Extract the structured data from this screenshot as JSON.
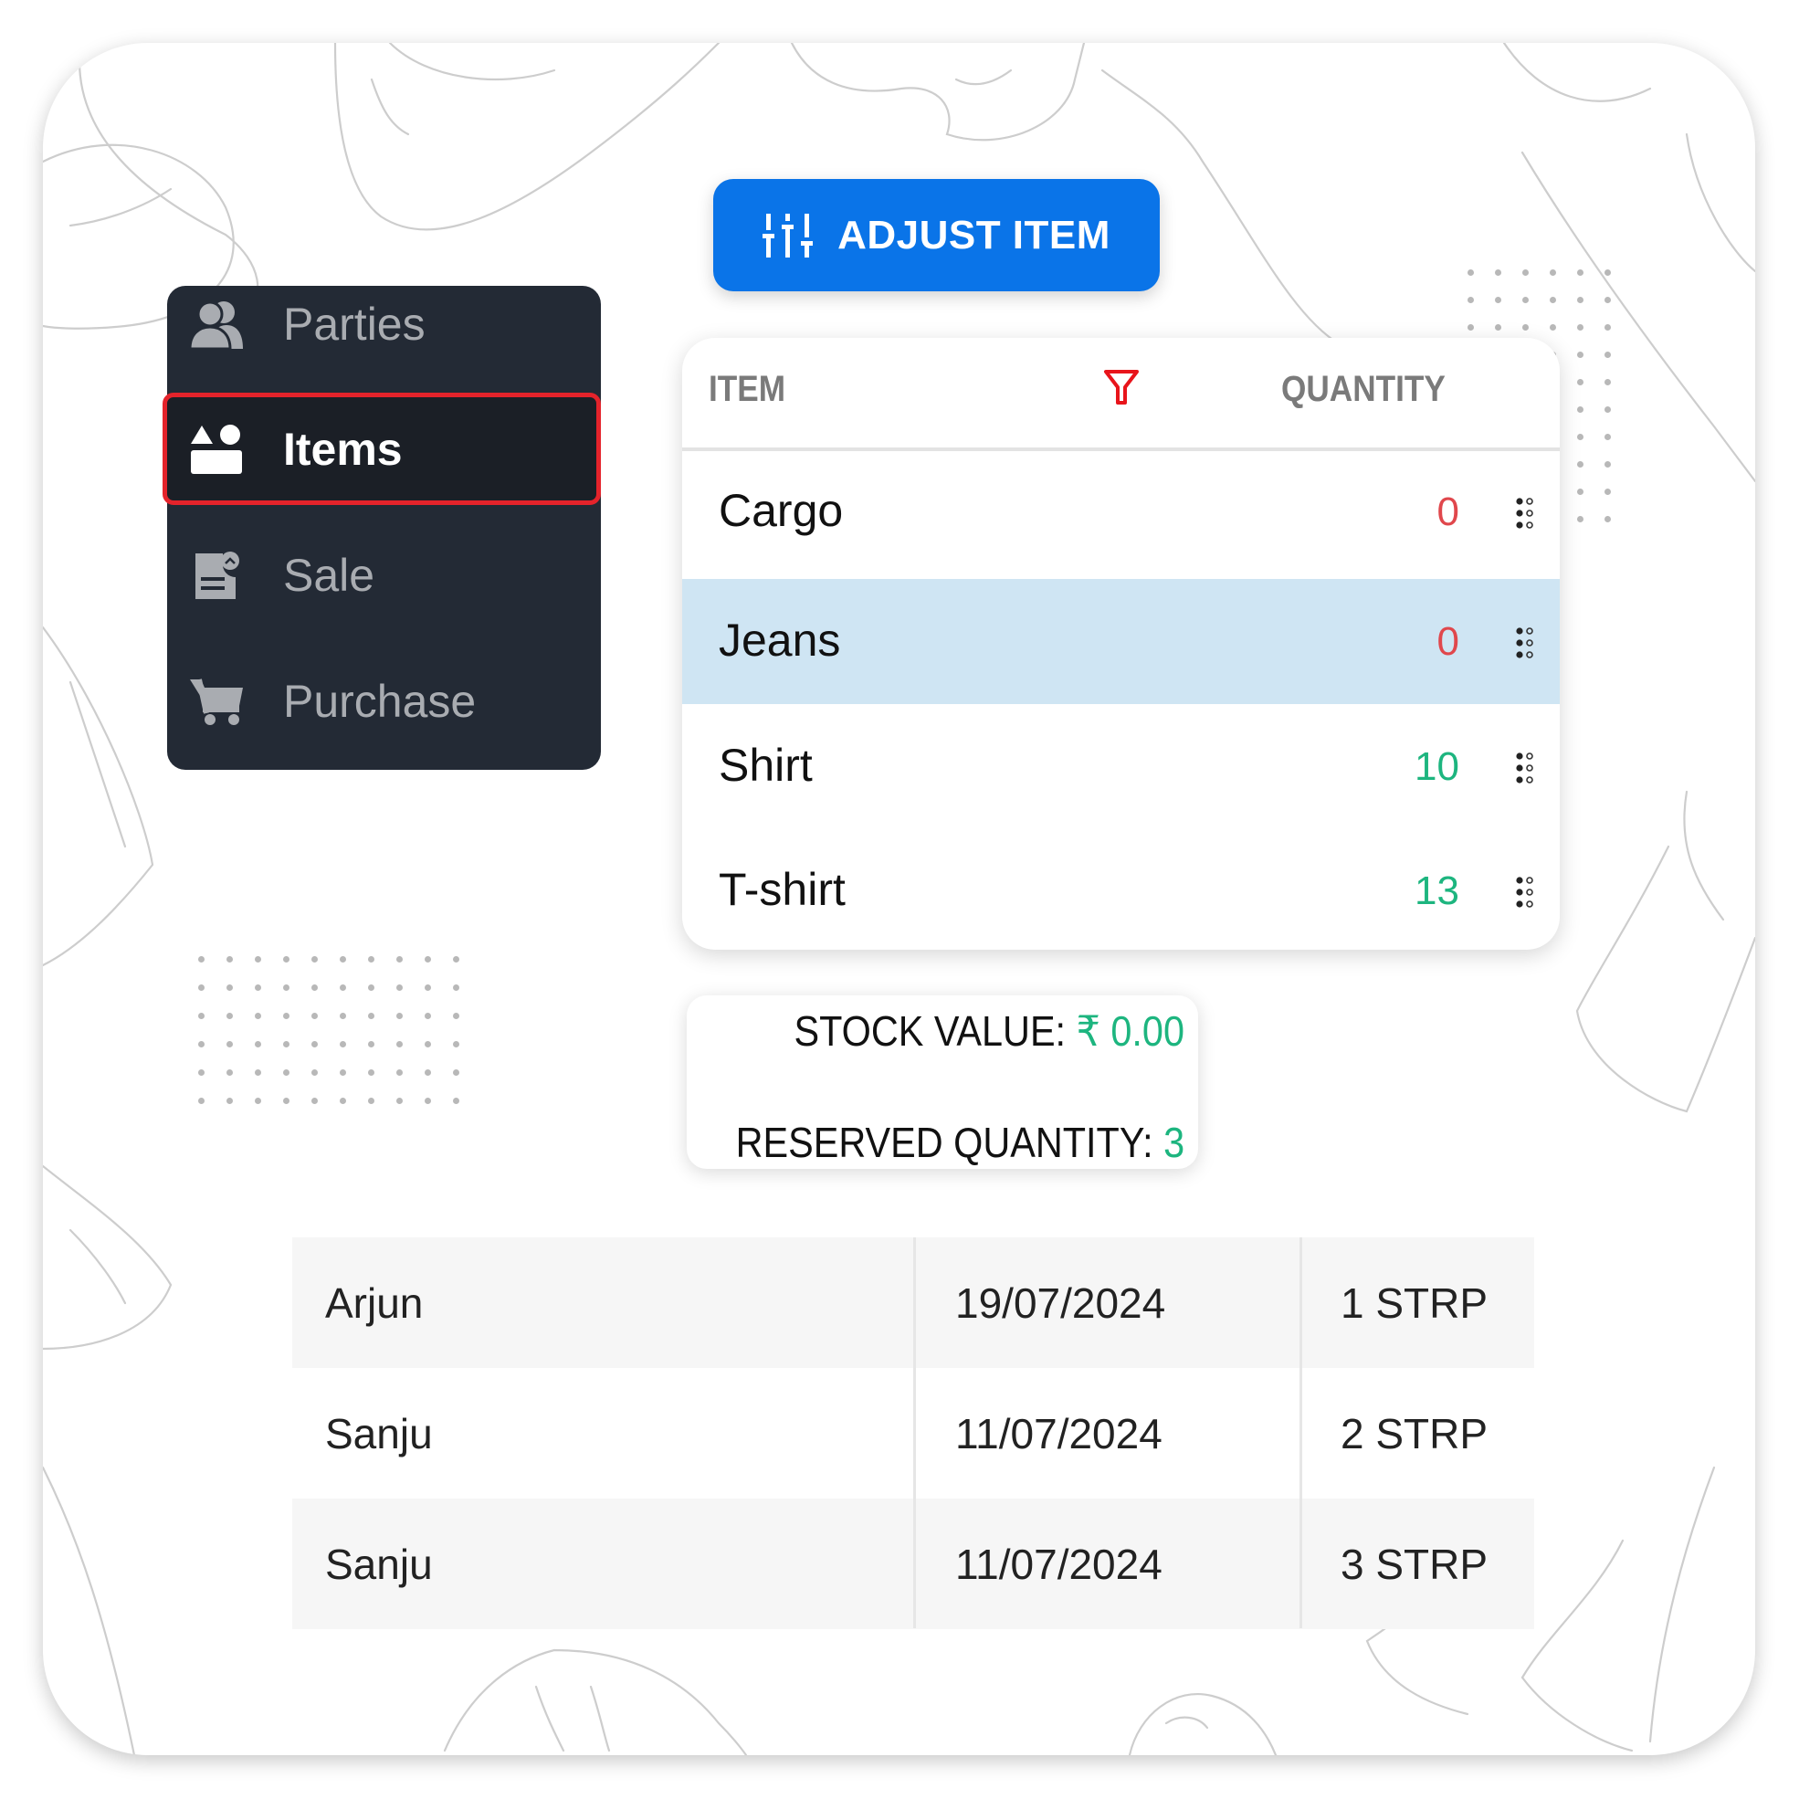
{
  "toolbar": {
    "adjust_item_label": "ADJUST ITEM",
    "adjust_item_icon": "sliders-icon"
  },
  "sidebar": {
    "items": [
      {
        "label": "Parties",
        "icon": "users-icon",
        "active": false
      },
      {
        "label": "Items",
        "icon": "shapes-icon",
        "active": true
      },
      {
        "label": "Sale",
        "icon": "sale-document-icon",
        "active": false
      },
      {
        "label": "Purchase",
        "icon": "cart-icon",
        "active": false
      }
    ]
  },
  "items_table": {
    "headers": {
      "item": "ITEM",
      "quantity": "QUANTITY"
    },
    "filter_icon": "filter-icon",
    "rows": [
      {
        "name": "Cargo",
        "quantity": "0",
        "status": "zero",
        "selected": false
      },
      {
        "name": "Jeans",
        "quantity": "0",
        "status": "zero",
        "selected": true
      },
      {
        "name": "Shirt",
        "quantity": "10",
        "status": "positive",
        "selected": false
      },
      {
        "name": "T-shirt",
        "quantity": "13",
        "status": "positive",
        "selected": false
      }
    ]
  },
  "summary": {
    "stock_value_label": "STOCK VALUE: ",
    "stock_value": "₹ 0.00",
    "reserved_quantity_label": "RESERVED QUANTITY: ",
    "reserved_quantity": "3"
  },
  "reservations": {
    "rows": [
      {
        "party": "Arjun",
        "date": "19/07/2024",
        "quantity": "1 STRP"
      },
      {
        "party": "Sanju",
        "date": "11/07/2024",
        "quantity": "2 STRP"
      },
      {
        "party": "Sanju",
        "date": "11/07/2024",
        "quantity": "3 STRP"
      }
    ]
  },
  "colors": {
    "accent": "#0a74e8",
    "sidebar_bg": "#232a35",
    "active_outline": "#e4232b",
    "selected_row": "#cfe5f3",
    "positive": "#1db57f",
    "zero": "#e0474c"
  }
}
